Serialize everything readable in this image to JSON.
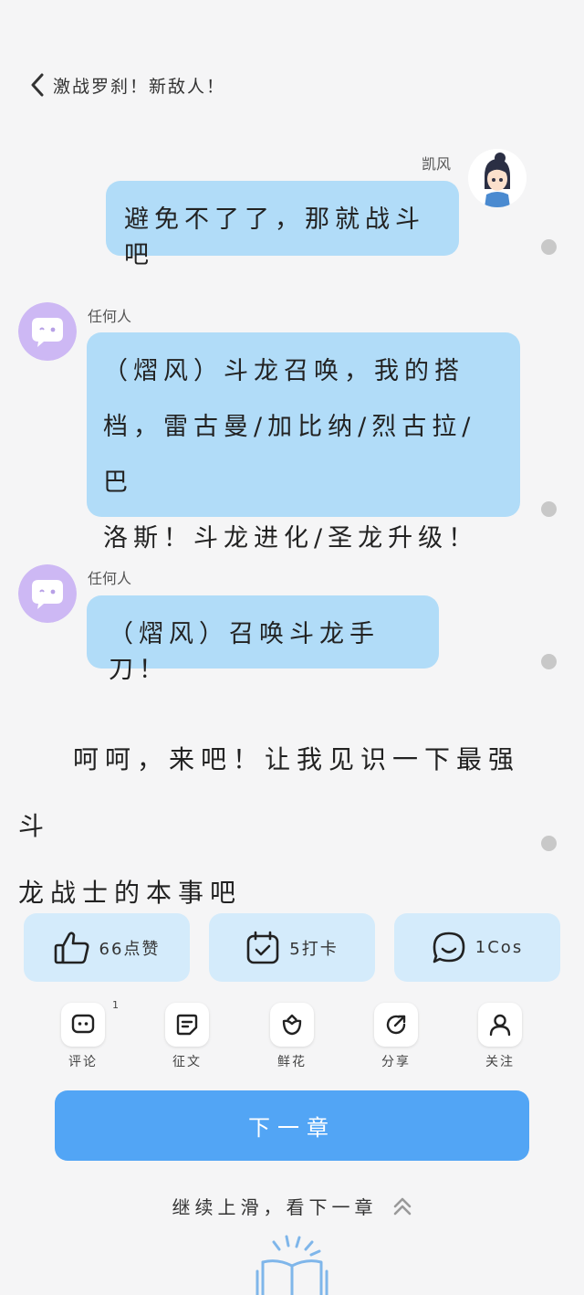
{
  "header": {
    "title": "激战罗刹！新敌人！"
  },
  "messages": [
    {
      "speaker": "凯风",
      "side": "right",
      "text": "避免不了了，那就战斗吧"
    },
    {
      "speaker": "任何人",
      "side": "left",
      "lines": [
        "（熠风）斗龙召唤，我的搭",
        "档，雷古曼/加比纳/烈古拉/巴",
        "洛斯！斗龙进化/圣龙升级！"
      ]
    },
    {
      "speaker": "任何人",
      "side": "left",
      "text": "（熠风）召唤斗龙手刀！"
    }
  ],
  "narration": {
    "line1": "呵呵，来吧！让我见识一下最强斗",
    "line2": "龙战士的本事吧"
  },
  "stats": {
    "likes": "66点赞",
    "checkin": "5打卡",
    "cos": "1Cos"
  },
  "actions": {
    "comment": "评论",
    "comment_badge": "1",
    "essay": "征文",
    "flower": "鲜花",
    "share": "分享",
    "follow": "关注"
  },
  "next_button": "下一章",
  "swipe_hint": "继续上滑，看下一章",
  "colors": {
    "bubble": "#b1dcf8",
    "stat_bg": "#d4ebfb",
    "primary": "#52a5f5",
    "avatar_purple": "#cdb8f4"
  }
}
